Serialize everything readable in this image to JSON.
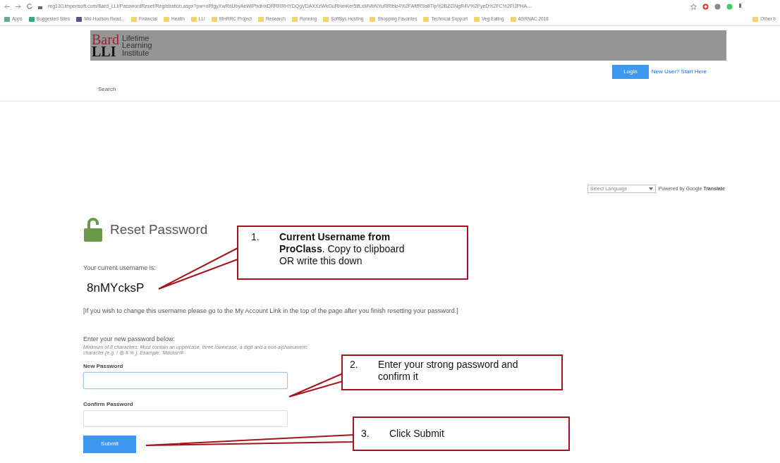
{
  "browser": {
    "url": "reg130.imperisoft.com/Bard_LLI/PasswordReset/Registration.aspx?pw=oRfgyXwRdUbyAeWiPhdHxDRRRRHYDQgVDAXXzWkGuRHmKer5ifLxMVbNYuRRiblc4%2FAfIfR9a8Tlp%2BZGNgR4V%2FyeD%2FC%2FIJPHA…",
    "bookmarks": [
      "Apps",
      "Suggested Sites",
      "Mid-Hudson Read...",
      "Financial",
      "Health",
      "LLI",
      "MHRRC Project",
      "Research",
      "Running",
      "SoftSys Hosting",
      "Shopping Favorites",
      "Technical Support",
      "Veg Eating",
      "ASRNAC 2018"
    ],
    "other_bookmarks": "Other b"
  },
  "header": {
    "logo_top": "Bard",
    "logo_bottom": "LLI",
    "logo_name": [
      "Lifetime",
      "Learning",
      "Institute"
    ],
    "login_button": "Login",
    "new_user_link": "New User? Start Here",
    "search_link": "Search"
  },
  "translate": {
    "select": "Select Language",
    "powered_by": "Powered by Google **Translate**"
  },
  "reset": {
    "title": "Reset Password",
    "username_label": "Your current username is:",
    "username": "8nMYcksP",
    "note": "[If you wish to change this username please go to the My Account Link in the top of the page after you finish resetting your password.]",
    "instructions": "Enter your new password below:",
    "hint": "Minimum of 8 characters. Must contain an uppercase, three lowercase, a digit and a non-alphanumeric character (e.g. ! @ # % ). Example: 'Mdckor!#'",
    "fields": [
      {
        "label": "New Password",
        "focused": true
      },
      {
        "label": "Confirm Password",
        "focused": false
      }
    ],
    "submit": "Submit"
  },
  "annotations": [
    {
      "number": "1.",
      "text": "**Current Username from ProClass**. Copy to clipboard OR write this down"
    },
    {
      "number": "2.",
      "text": "Enter your strong password and confirm it"
    },
    {
      "number": "3.",
      "text": "Click Submit"
    }
  ]
}
